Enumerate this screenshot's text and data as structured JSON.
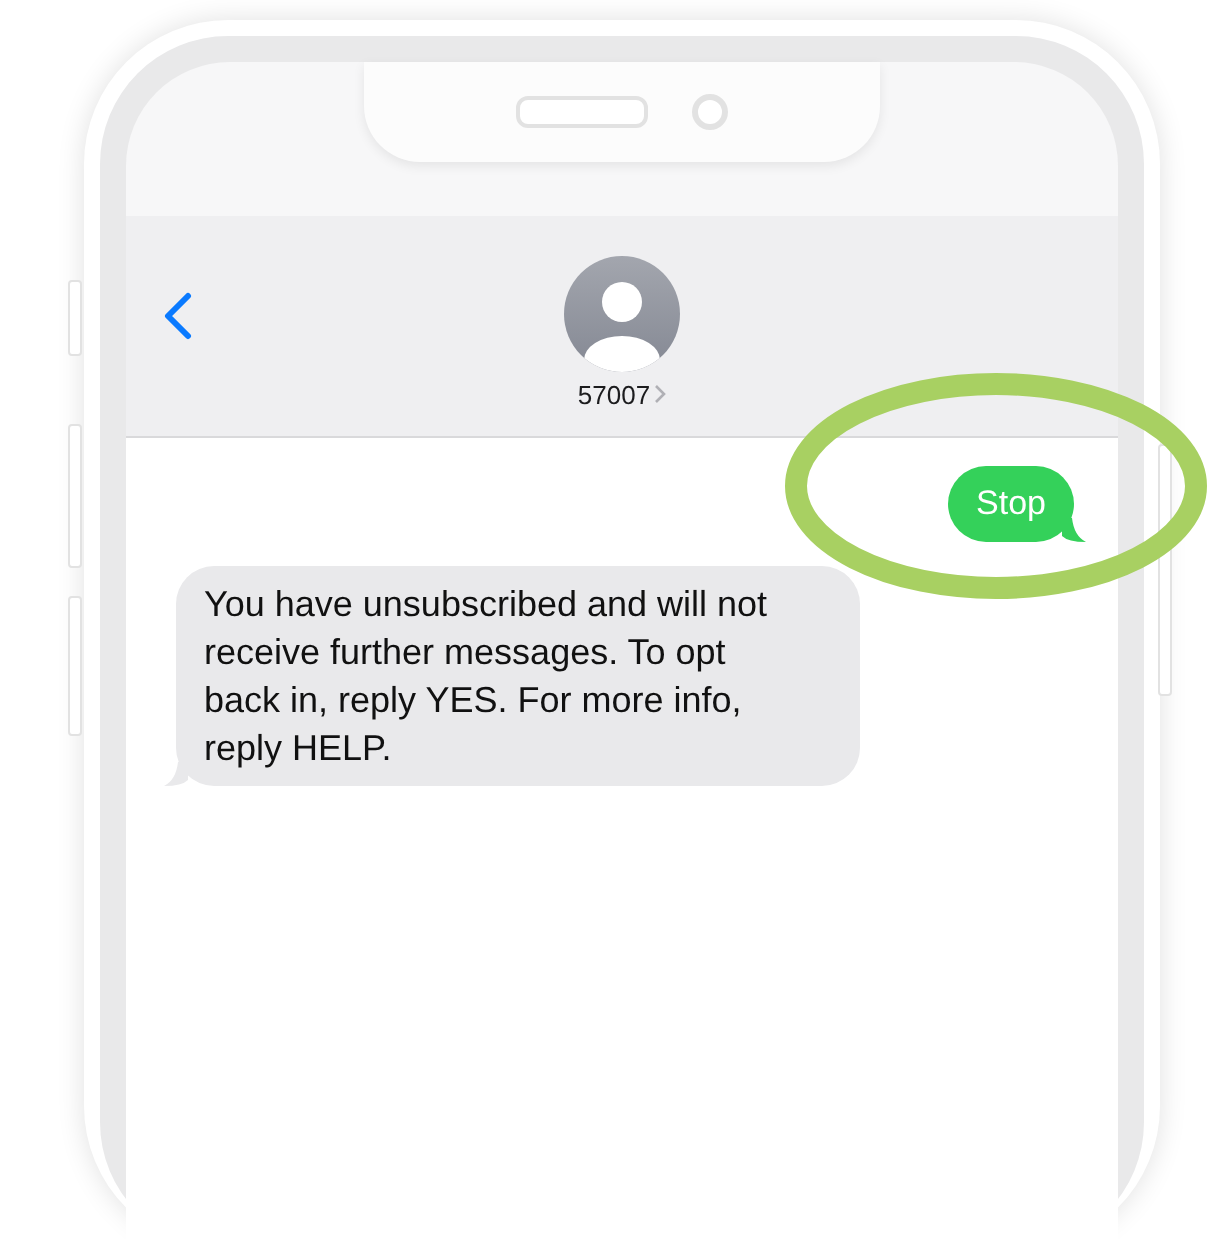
{
  "header": {
    "contact": "57007"
  },
  "messages": [
    {
      "kind": "sent",
      "text": "Stop",
      "highlighted": true
    },
    {
      "kind": "received",
      "text": "You have unsubscribed and will not receive further messages. To opt back in, reply YES. For more info, reply HELP.",
      "highlighted": false
    }
  ]
}
